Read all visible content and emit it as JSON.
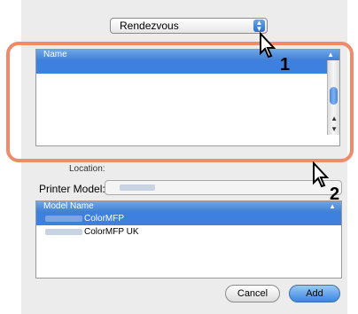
{
  "popup": {
    "value": "Rendezvous"
  },
  "printer_list": {
    "header": "Name",
    "rows": [
      ""
    ]
  },
  "location": {
    "label": "Location:"
  },
  "printer_model": {
    "label": "Printer Model:"
  },
  "model_list": {
    "header": "Model Name",
    "rows": [
      {
        "text": "ColorMFP",
        "selected": true
      },
      {
        "text": "ColorMFP UK",
        "selected": false
      }
    ]
  },
  "buttons": {
    "cancel": "Cancel",
    "add": "Add"
  },
  "annotations": {
    "step1": "1",
    "step2": "2"
  },
  "colors": {
    "highlight": "#ef8a6a",
    "selection": "#3d80df"
  }
}
